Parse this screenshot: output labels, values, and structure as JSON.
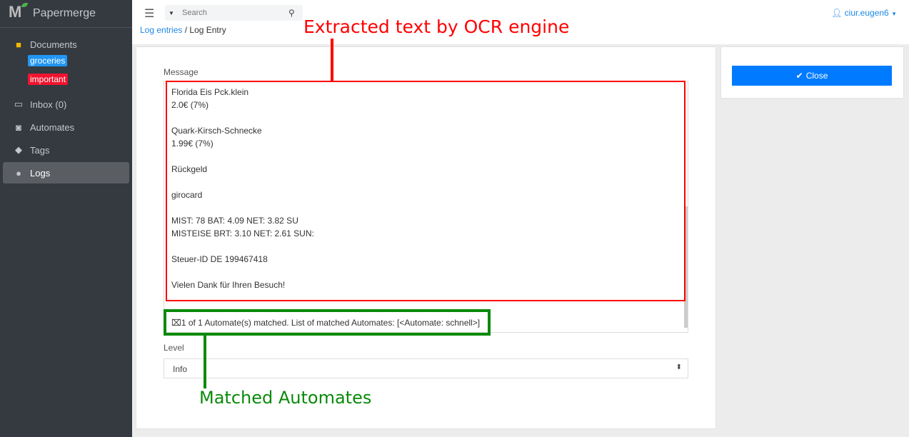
{
  "app": {
    "name": "Papermerge"
  },
  "sidebar": {
    "items": [
      {
        "label": "Documents",
        "icon": "folder-icon"
      },
      {
        "label": "Inbox (0)",
        "icon": "inbox-icon"
      },
      {
        "label": "Automates",
        "icon": "robot-icon"
      },
      {
        "label": "Tags",
        "icon": "tag-icon"
      },
      {
        "label": "Logs",
        "icon": "lightbulb-icon"
      }
    ],
    "tags": [
      {
        "label": "groceries",
        "color": "#2196f3"
      },
      {
        "label": "important",
        "color": "#f0142f"
      }
    ]
  },
  "topbar": {
    "search_placeholder": "Search",
    "user": "ciur.eugen6"
  },
  "breadcrumb": {
    "parent": "Log entries",
    "separator": " / ",
    "current": "Log Entry"
  },
  "form": {
    "message_label": "Message",
    "message_text": "Florida Eis Pck.klein\n2.0€ (7%)\n\nQuark-Kirsch-Schnecke\n1.99€ (7%)\n\nRückgeld\n\ngirocard\n\nMIST: 78 BAT: 4.09 NET: 3.82 SU\nMISTEISE  BRT: 3.10 NET: 2.61 SUN:\n\nSteuer-ID DE 199467418\n\nVielen Dank für Ihren Besuch!",
    "automates_text": "1 of 1 Automate(s) matched. List of matched Automates: [<Automate: schnell>]",
    "level_label": "Level",
    "level_value": "Info"
  },
  "actions": {
    "close_label": "Close"
  },
  "annotations": {
    "ocr": "Extracted text by OCR engine",
    "automates": "Matched Automates"
  },
  "colors": {
    "accent": "#007bff",
    "sidebar": "#343a40",
    "annotation_red": "#ff0000",
    "annotation_green": "#0a8a0a"
  }
}
